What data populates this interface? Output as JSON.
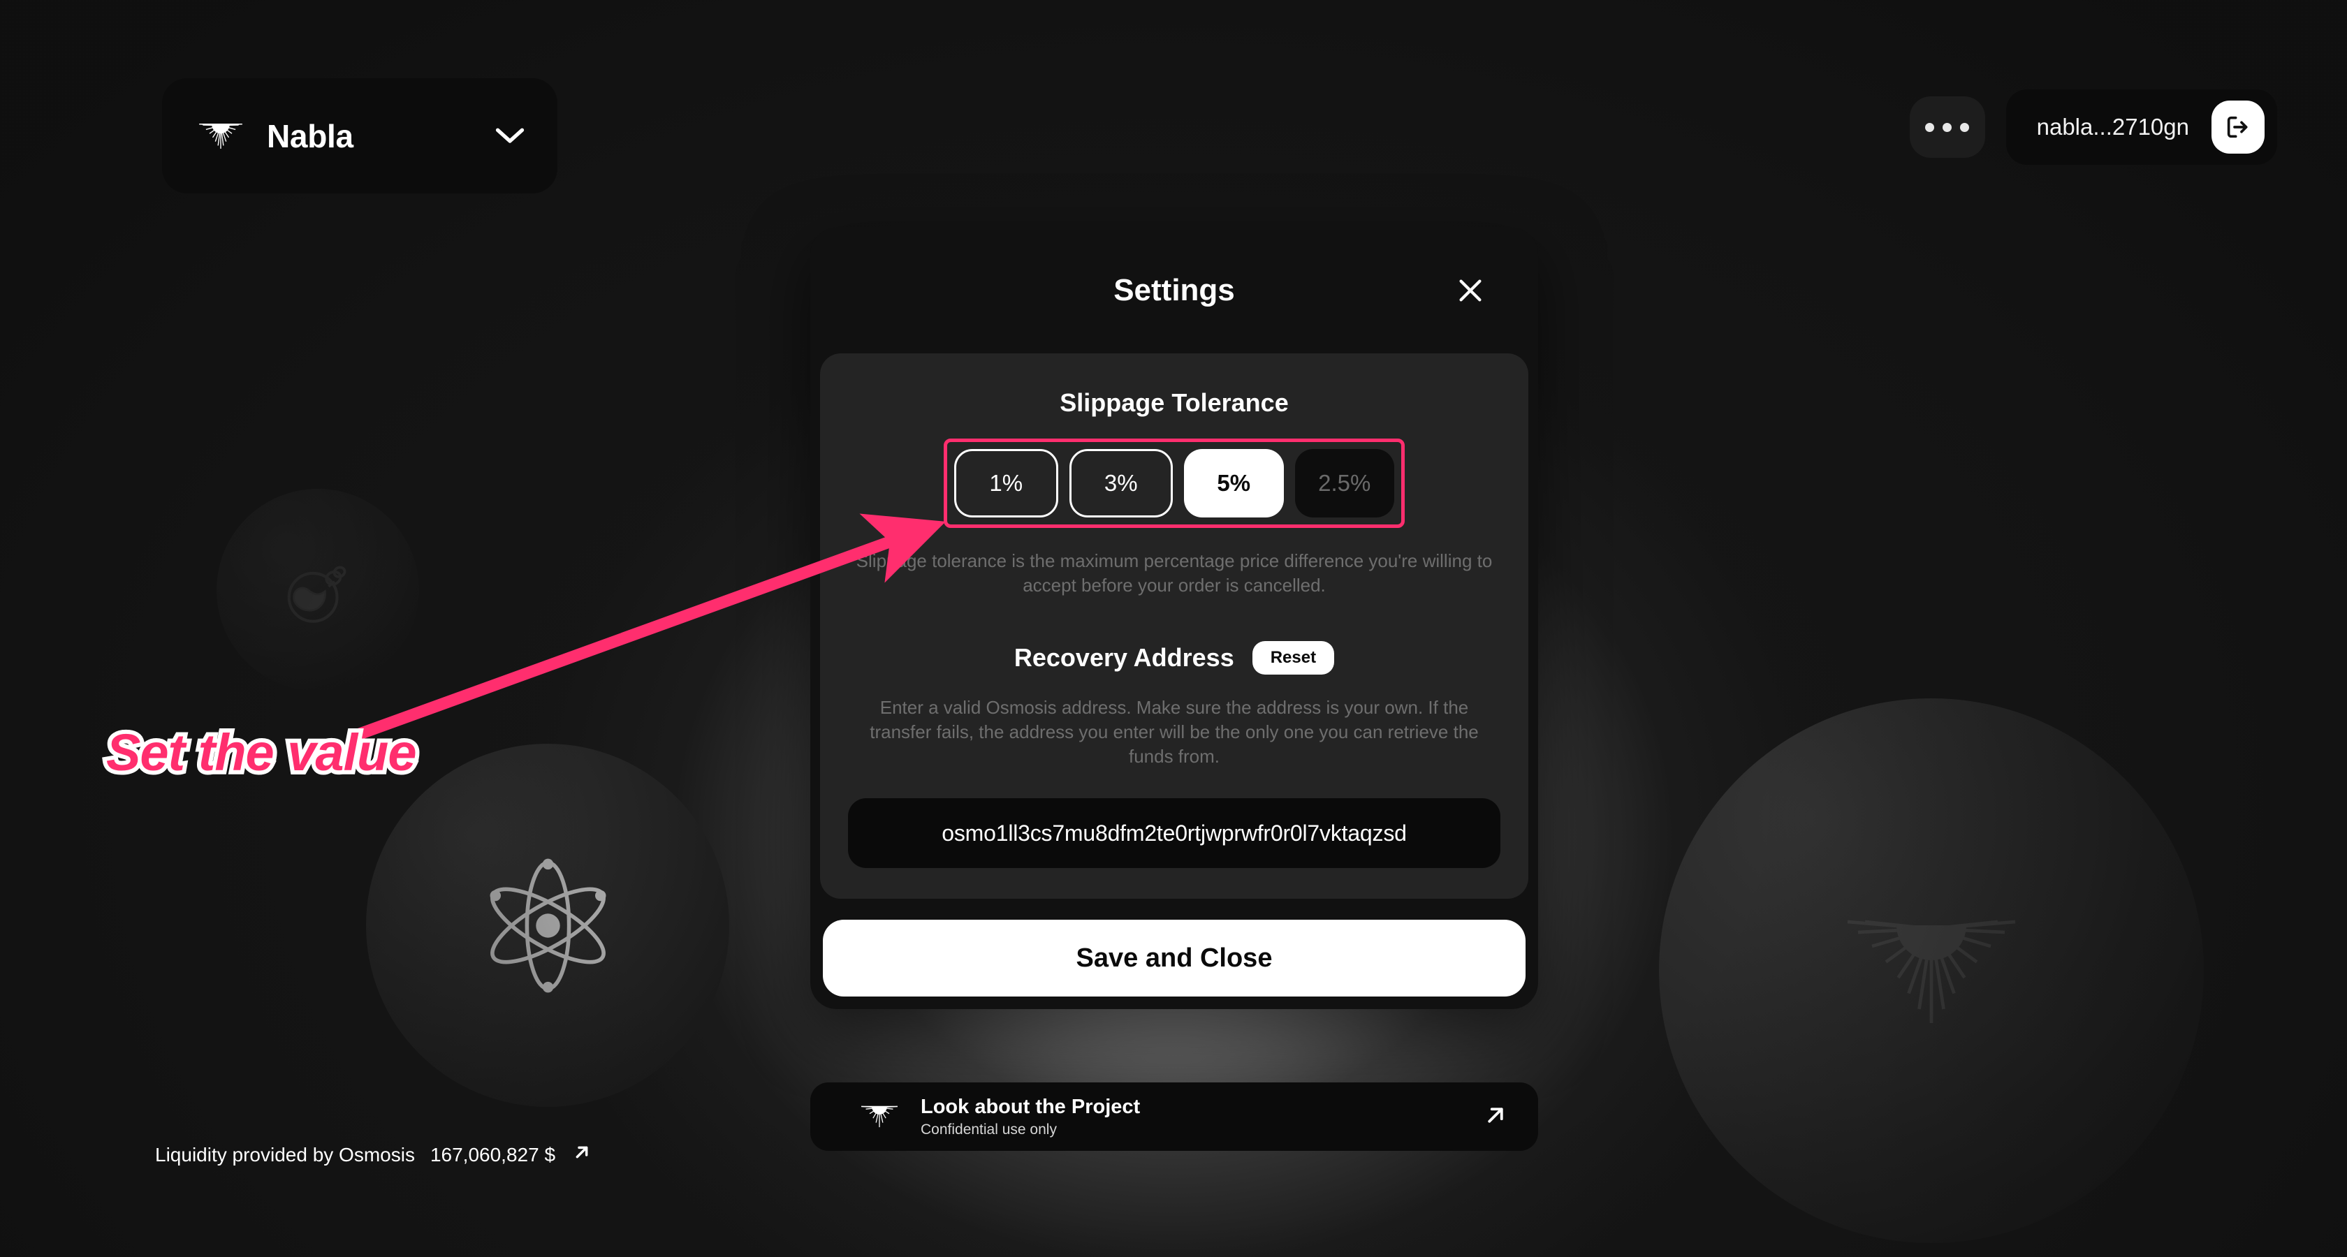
{
  "header": {
    "chain_selector": {
      "label": "Nabla",
      "logo_icon": "nabla-sunburst-icon",
      "chevron_icon": "chevron-down-icon"
    },
    "more_button": {
      "icon": "ellipsis-icon",
      "label": ""
    },
    "wallet": {
      "address": "nabla...2710gn",
      "logout_icon": "logout-icon"
    }
  },
  "modal": {
    "title": "Settings",
    "close_icon": "close-icon",
    "slippage": {
      "title": "Slippage Tolerance",
      "options": [
        {
          "label": "1%",
          "state": "outline"
        },
        {
          "label": "3%",
          "state": "outline"
        },
        {
          "label": "5%",
          "state": "selected"
        },
        {
          "label": "2.5%",
          "state": "custom-input"
        }
      ],
      "custom_placeholder": "2.5%",
      "helper": "Slippage tolerance is the maximum percentage price difference you're willing to accept before your order is cancelled."
    },
    "recovery": {
      "title": "Recovery Address",
      "reset_label": "Reset",
      "helper": "Enter a valid Osmosis address. Make sure the address is your own. If the transfer fails, the address you enter will be the only one you can retrieve the funds from.",
      "address_value": "osmo1ll3cs7mu8dfm2te0rtjwprwfr0r0l7vktaqzsd"
    },
    "save_label": "Save and Close"
  },
  "project_banner": {
    "title": "Look about the Project",
    "subtitle": "Confidential use only",
    "logo_icon": "nabla-sunburst-icon",
    "external_icon": "arrow-up-right-icon"
  },
  "footer": {
    "liquidity_label": "Liquidity provided by Osmosis",
    "liquidity_value": "167,060,827 $",
    "external_icon": "arrow-up-right-icon"
  },
  "annotation": {
    "text": "Set the value",
    "color": "#ff2e6e",
    "arrow_icon": "annotation-arrow-icon"
  },
  "background": {
    "tokens": [
      {
        "icon": "bomb-token-icon"
      },
      {
        "icon": "atom-cosmos-icon"
      },
      {
        "icon": "nabla-sunburst-icon"
      }
    ]
  },
  "colors": {
    "accent_pink": "#ff2e6e",
    "panel": "#242424",
    "modal": "#111111",
    "white": "#ffffff"
  }
}
